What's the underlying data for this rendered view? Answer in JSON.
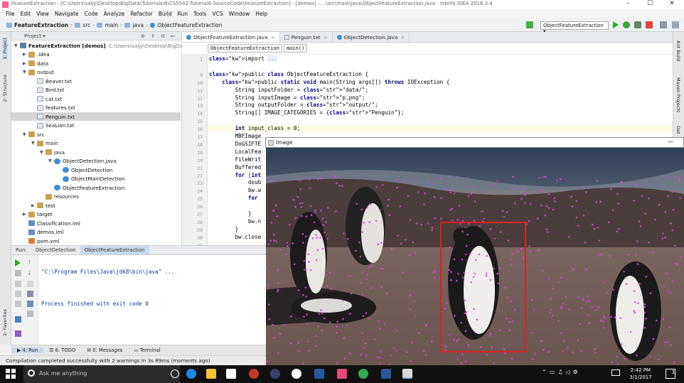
{
  "window": {
    "title": "FeatureExtraction - [C:\\Users\\saijy\\Desktop\\BigData\\Tutorials\\6\\CS5542-Tutorial6-SourceCode\\FeatureExtraction] - [demos] - ...\\src\\main\\java\\ObjectFeatureExtraction.java - IntelliJ IDEA 2016.3.4",
    "controls": [
      "–",
      "☐",
      "✕"
    ]
  },
  "menu": [
    "File",
    "Edit",
    "View",
    "Navigate",
    "Code",
    "Analyze",
    "Refactor",
    "Build",
    "Run",
    "Tools",
    "VCS",
    "Window",
    "Help"
  ],
  "navbar": {
    "crumbs": [
      "FeatureExtraction",
      "src",
      "main",
      "java",
      "ObjectFeatureExtraction"
    ],
    "run_config": "ObjectFeatureExtraction"
  },
  "left_tool_tabs": [
    "1: Project",
    "2: Structure",
    "2: Favorites"
  ],
  "project": {
    "header": "Project",
    "tree": [
      {
        "label": "FeatureExtraction [demos]",
        "extra": "C:\\Users\\saijy\\Desktop\\BigData\\Tutori",
        "icon": "module-icon",
        "arrow": "▼",
        "depth": 0
      },
      {
        "label": ".idea",
        "icon": "folder-icon",
        "arrow": "▶",
        "depth": 1
      },
      {
        "label": "data",
        "icon": "folder-icon",
        "arrow": "▶",
        "depth": 1
      },
      {
        "label": "output",
        "icon": "folder-icon",
        "arrow": "▼",
        "depth": 1
      },
      {
        "label": "Beaver.txt",
        "icon": "text-file-icon",
        "arrow": "",
        "depth": 2
      },
      {
        "label": "Bird.txt",
        "icon": "text-file-icon",
        "arrow": "",
        "depth": 2
      },
      {
        "label": "cat.txt",
        "icon": "text-file-icon",
        "arrow": "",
        "depth": 2
      },
      {
        "label": "features.txt",
        "icon": "text-file-icon",
        "arrow": "",
        "depth": 2
      },
      {
        "label": "Penguin.txt",
        "icon": "text-file-icon",
        "arrow": "",
        "depth": 2,
        "selected": true
      },
      {
        "label": "SeaLion.txt",
        "icon": "text-file-icon",
        "arrow": "",
        "depth": 2
      },
      {
        "label": "src",
        "icon": "folder-icon",
        "arrow": "▼",
        "depth": 1
      },
      {
        "label": "main",
        "icon": "folder-icon",
        "arrow": "▼",
        "depth": 2
      },
      {
        "label": "java",
        "icon": "folder-icon",
        "arrow": "▼",
        "depth": 3
      },
      {
        "label": "ObjectDetection.java",
        "icon": "java-class-icon",
        "arrow": "▼",
        "depth": 4
      },
      {
        "label": "ObjectDetection",
        "icon": "java-class-icon",
        "arrow": "",
        "depth": 5
      },
      {
        "label": "ObjectMainDetection",
        "icon": "java-class-icon",
        "arrow": "",
        "depth": 5
      },
      {
        "label": "ObjectFeatureExtraction",
        "icon": "java-class-icon",
        "arrow": "",
        "depth": 4
      },
      {
        "label": "resources",
        "icon": "folder-icon",
        "arrow": "",
        "depth": 3
      },
      {
        "label": "test",
        "icon": "folder-icon",
        "arrow": "▶",
        "depth": 2
      },
      {
        "label": "target",
        "icon": "folder-icon",
        "arrow": "▶",
        "depth": 1
      },
      {
        "label": "Classification.iml",
        "icon": "iml-file-icon",
        "arrow": "",
        "depth": 1
      },
      {
        "label": "demos.iml",
        "icon": "iml-file-icon",
        "arrow": "",
        "depth": 1
      },
      {
        "label": "pom.xml",
        "icon": "xml-file-icon",
        "arrow": "",
        "depth": 1
      }
    ]
  },
  "editor": {
    "tabs": [
      {
        "label": "ObjectFeatureExtraction.java",
        "icon": "java-class-icon",
        "active": true
      },
      {
        "label": "Penguin.txt",
        "icon": "text-file-icon",
        "active": false
      },
      {
        "label": "ObjectDetection.java",
        "icon": "java-class-icon",
        "active": false
      }
    ],
    "breadcrumbs": [
      "ObjectFeatureExtraction",
      "main()"
    ],
    "line_numbers": [
      "1",
      "",
      "9",
      "10",
      "11",
      "12",
      "13",
      "14",
      "15",
      "16",
      "17",
      "18",
      "19",
      "20",
      "21",
      "22",
      "23",
      "24",
      "25",
      "26",
      "27",
      "28",
      "29",
      "30",
      "31"
    ],
    "lines": [
      {
        "text": "import ...",
        "highlight": false
      },
      {
        "text": "",
        "highlight": false
      },
      {
        "text": "public class ObjectFeatureExtraction {",
        "highlight": false
      },
      {
        "text": "    public static void main(String args[]) throws IOException {",
        "highlight": false
      },
      {
        "text": "        String inputFolder = \"data/\";",
        "highlight": false
      },
      {
        "text": "        String inputImage = \"p.png\";",
        "highlight": false
      },
      {
        "text": "        String outputFolder = \"output/\";",
        "highlight": false
      },
      {
        "text": "        String[] IMAGE_CATEGORIES = {\"Penguin\"};",
        "highlight": false
      },
      {
        "text": "",
        "highlight": false
      },
      {
        "text": "        int input_class = 0;",
        "highlight": true
      },
      {
        "text": "        MBFImage",
        "highlight": false
      },
      {
        "text": "        DoGSIFTE",
        "highlight": false
      },
      {
        "text": "        LocalFea",
        "highlight": false
      },
      {
        "text": "        FileWrit",
        "highlight": false
      },
      {
        "text": "        Buffered",
        "highlight": false
      },
      {
        "text": "        for (int",
        "highlight": false
      },
      {
        "text": "            doub",
        "highlight": false
      },
      {
        "text": "            bw.w",
        "highlight": false
      },
      {
        "text": "            for",
        "highlight": false
      },
      {
        "text": "",
        "highlight": false
      },
      {
        "text": "            }",
        "highlight": false
      },
      {
        "text": "            bw.n",
        "highlight": false
      },
      {
        "text": "        }",
        "highlight": false
      },
      {
        "text": "        bw.close",
        "highlight": false
      }
    ]
  },
  "right_tool_tabs": [
    "Ant Build",
    "Maven Projects",
    "Dat"
  ],
  "run": {
    "label": "Run:",
    "tabs": [
      "ObjectDetection",
      "ObjectFeatureExtraction"
    ],
    "output": [
      "\"C:\\Program Files\\Java\\jdk8\\bin\\java\" ...",
      "",
      "Process finished with exit code 0"
    ]
  },
  "tool_windows": [
    "4: Run",
    "6: TODO",
    "0: Messages",
    "Terminal"
  ],
  "status": "Compilation completed successfully with 2 warnings in 3s 89ms (moments ago)",
  "image_window": {
    "title": "Image",
    "close": "—",
    "box_color": "#e02020",
    "keypoint_color": "#e040e0"
  },
  "taskbar": {
    "search_placeholder": "Ask me anything",
    "time": "2:42 PM",
    "date": "3/1/2017",
    "notifications": "3"
  }
}
